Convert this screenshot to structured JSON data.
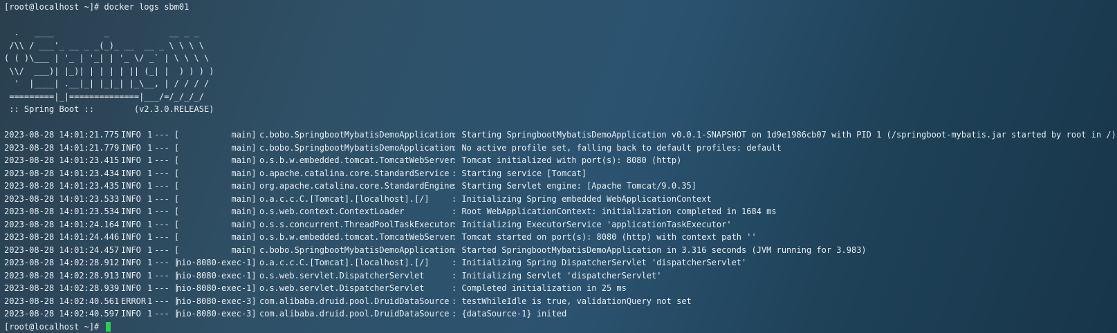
{
  "terminal": {
    "prompt_line": "[root@localhost ~]# docker logs sbm01",
    "banner": [
      "  .   ____          _            __ _ _",
      " /\\\\ / ___'_ __ _ _(_)_ __  __ _ \\ \\ \\ \\",
      "( ( )\\___ | '_ | '_| | '_ \\/ _` | \\ \\ \\ \\",
      " \\\\/  ___)| |_)| | | | | || (_| |  ) ) ) )",
      "  '  |____| .__|_| |_|_| |_\\__, | / / / /",
      " =========|_|==============|___/=/_/_/_/",
      " :: Spring Boot ::        (v2.3.0.RELEASE)"
    ],
    "logs": [
      {
        "ts": "2023-08-28 14:01:21.775",
        "level": "INFO",
        "pid": "1",
        "sep": "--- [",
        "thread": "           main]",
        "logger": "c.bobo.SpringbootMybatisDemoApplication",
        "msg": ": Starting SpringbootMybatisDemoApplication v0.0.1-SNAPSHOT on 1d9e1986cb07 with PID 1 (/springboot-mybatis.jar started by root in /)"
      },
      {
        "ts": "2023-08-28 14:01:21.779",
        "level": "INFO",
        "pid": "1",
        "sep": "--- [",
        "thread": "           main]",
        "logger": "c.bobo.SpringbootMybatisDemoApplication",
        "msg": ": No active profile set, falling back to default profiles: default"
      },
      {
        "ts": "2023-08-28 14:01:23.415",
        "level": "INFO",
        "pid": "1",
        "sep": "--- [",
        "thread": "           main]",
        "logger": "o.s.b.w.embedded.tomcat.TomcatWebServer",
        "msg": ": Tomcat initialized with port(s): 8080 (http)"
      },
      {
        "ts": "2023-08-28 14:01:23.434",
        "level": "INFO",
        "pid": "1",
        "sep": "--- [",
        "thread": "           main]",
        "logger": "o.apache.catalina.core.StandardService",
        "msg": ": Starting service [Tomcat]"
      },
      {
        "ts": "2023-08-28 14:01:23.435",
        "level": "INFO",
        "pid": "1",
        "sep": "--- [",
        "thread": "           main]",
        "logger": "org.apache.catalina.core.StandardEngine",
        "msg": ": Starting Servlet engine: [Apache Tomcat/9.0.35]"
      },
      {
        "ts": "2023-08-28 14:01:23.533",
        "level": "INFO",
        "pid": "1",
        "sep": "--- [",
        "thread": "           main]",
        "logger": "o.a.c.c.C.[Tomcat].[localhost].[/]",
        "msg": ": Initializing Spring embedded WebApplicationContext"
      },
      {
        "ts": "2023-08-28 14:01:23.534",
        "level": "INFO",
        "pid": "1",
        "sep": "--- [",
        "thread": "           main]",
        "logger": "o.s.web.context.ContextLoader",
        "msg": ": Root WebApplicationContext: initialization completed in 1684 ms"
      },
      {
        "ts": "2023-08-28 14:01:24.164",
        "level": "INFO",
        "pid": "1",
        "sep": "--- [",
        "thread": "           main]",
        "logger": "o.s.s.concurrent.ThreadPoolTaskExecutor",
        "msg": ": Initializing ExecutorService 'applicationTaskExecutor'"
      },
      {
        "ts": "2023-08-28 14:01:24.446",
        "level": "INFO",
        "pid": "1",
        "sep": "--- [",
        "thread": "           main]",
        "logger": "o.s.b.w.embedded.tomcat.TomcatWebServer",
        "msg": ": Tomcat started on port(s): 8080 (http) with context path ''"
      },
      {
        "ts": "2023-08-28 14:01:24.457",
        "level": "INFO",
        "pid": "1",
        "sep": "--- [",
        "thread": "           main]",
        "logger": "c.bobo.SpringbootMybatisDemoApplication",
        "msg": ": Started SpringbootMybatisDemoApplication in 3.316 seconds (JVM running for 3.983)"
      },
      {
        "ts": "2023-08-28 14:02:28.912",
        "level": "INFO",
        "pid": "1",
        "sep": "--- [",
        "thread": "nio-8080-exec-1]",
        "logger": "o.a.c.c.C.[Tomcat].[localhost].[/]",
        "msg": ": Initializing Spring DispatcherServlet 'dispatcherServlet'"
      },
      {
        "ts": "2023-08-28 14:02:28.913",
        "level": "INFO",
        "pid": "1",
        "sep": "--- [",
        "thread": "nio-8080-exec-1]",
        "logger": "o.s.web.servlet.DispatcherServlet",
        "msg": ": Initializing Servlet 'dispatcherServlet'"
      },
      {
        "ts": "2023-08-28 14:02:28.939",
        "level": "INFO",
        "pid": "1",
        "sep": "--- [",
        "thread": "nio-8080-exec-1]",
        "logger": "o.s.web.servlet.DispatcherServlet",
        "msg": ": Completed initialization in 25 ms"
      },
      {
        "ts": "2023-08-28 14:02:40.561",
        "level": "ERROR",
        "pid": "1",
        "sep": "--- [",
        "thread": "nio-8080-exec-3]",
        "logger": "com.alibaba.druid.pool.DruidDataSource",
        "msg": ": testWhileIdle is true, validationQuery not set"
      },
      {
        "ts": "2023-08-28 14:02:40.597",
        "level": "INFO",
        "pid": "1",
        "sep": "--- [",
        "thread": "nio-8080-exec-3]",
        "logger": "com.alibaba.druid.pool.DruidDataSource",
        "msg": ": {dataSource-1} inited"
      }
    ],
    "final_prompt": "[root@localhost ~]#"
  }
}
